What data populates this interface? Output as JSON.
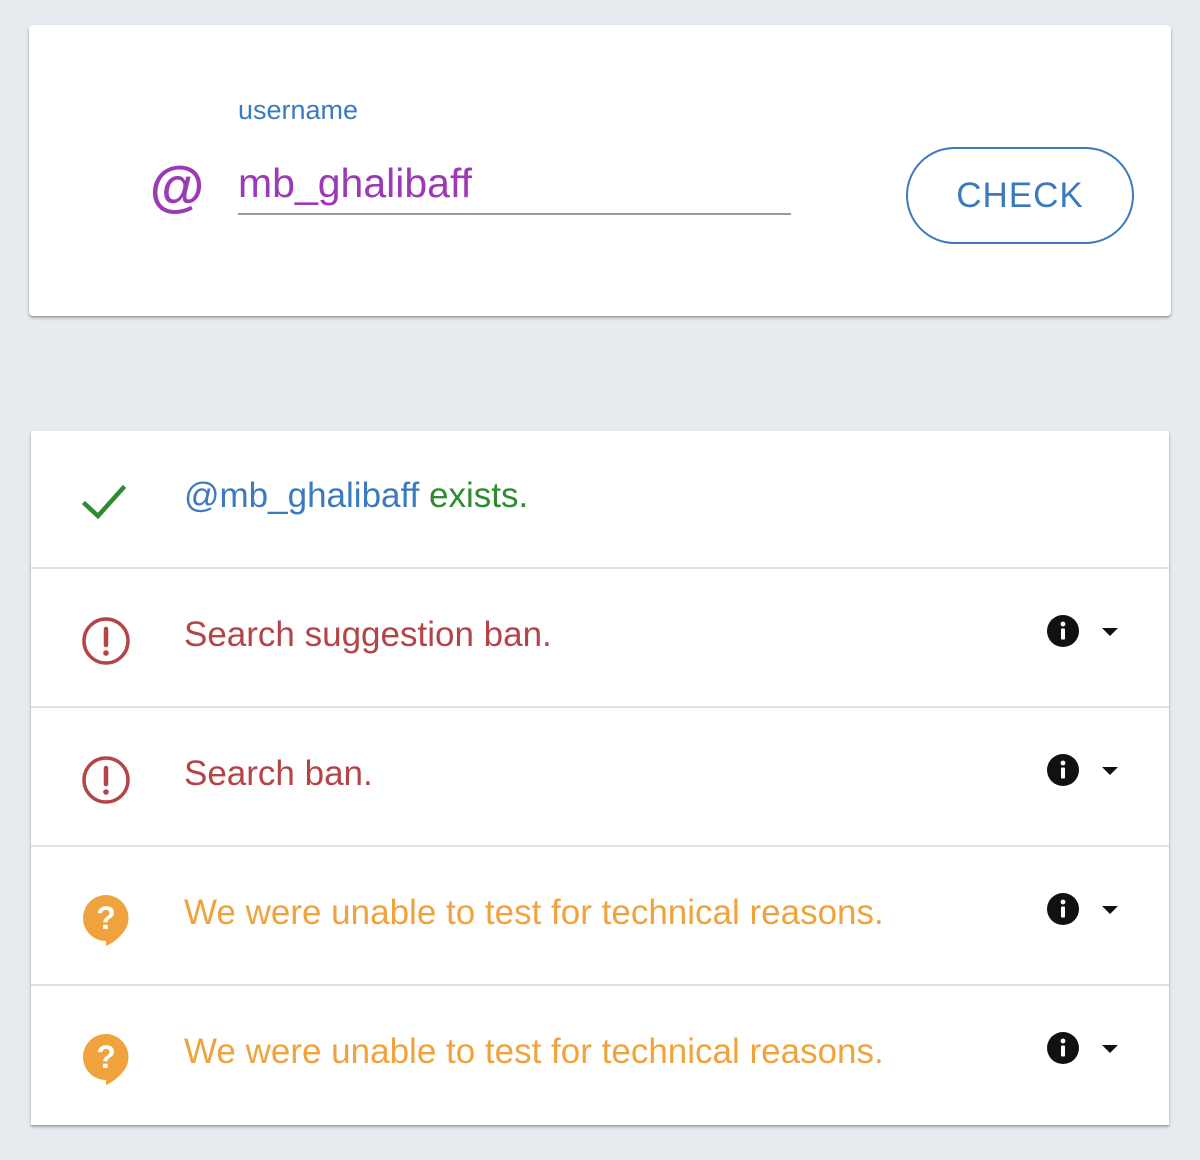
{
  "colors": {
    "page_background": "#e7ebef",
    "purple": "#9c39b6",
    "blue": "#3b7bbd",
    "green": "#2e8b2e",
    "red": "#b44448",
    "orange": "#f0a33c",
    "black": "#111111"
  },
  "search": {
    "label": "username",
    "value": "mb_ghalibaff",
    "at_symbol": "@",
    "button_label": "CHECK"
  },
  "results": {
    "exists": {
      "icon": "checkmark-icon",
      "handle": "@mb_ghalibaff",
      "text": " exists."
    },
    "rows": [
      {
        "icon": "alert-circle-icon",
        "text": "Search suggestion ban.",
        "status": "banned"
      },
      {
        "icon": "alert-circle-icon",
        "text": "Search ban.",
        "status": "banned"
      },
      {
        "icon": "help-bubble-icon",
        "text": "We were unable to test for technical reasons.",
        "status": "unknown"
      },
      {
        "icon": "help-bubble-icon",
        "text": "We were unable to test for technical reasons.",
        "status": "unknown"
      }
    ]
  }
}
